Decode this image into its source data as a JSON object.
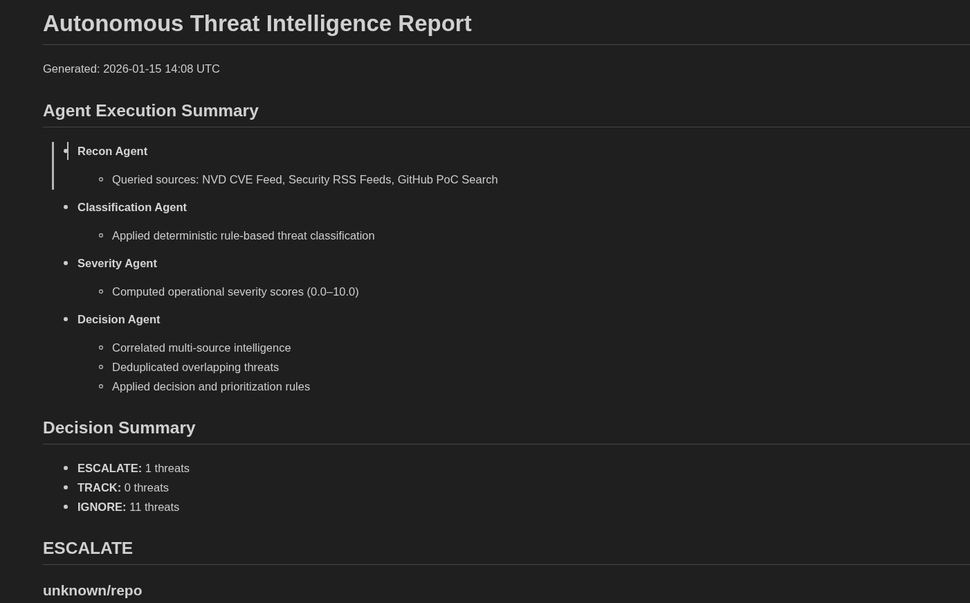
{
  "document": {
    "title": "Autonomous Threat Intelligence Report",
    "generated": "Generated: 2026-01-15 14:08 UTC"
  },
  "sections": [
    {
      "kind": "agents",
      "heading": "Agent Execution Summary",
      "items": [
        {
          "label": "Recon Agent",
          "highlighted": true,
          "children": [
            {
              "text": "Queried sources: NVD CVE Feed, Security RSS Feeds, GitHub PoC Search"
            }
          ]
        },
        {
          "label": "Classification Agent",
          "highlighted": false,
          "children": [
            {
              "text": "Applied deterministic rule-based threat classification"
            }
          ]
        },
        {
          "label": "Severity Agent",
          "highlighted": false,
          "children": [
            {
              "text": "Computed operational severity scores (0.0–10.0)"
            }
          ]
        },
        {
          "label": "Decision Agent",
          "highlighted": false,
          "children": [
            {
              "text": "Correlated multi-source intelligence"
            },
            {
              "text": "Deduplicated overlapping threats"
            },
            {
              "text": "Applied decision and prioritization rules"
            }
          ]
        }
      ]
    },
    {
      "kind": "counts",
      "heading": "Decision Summary",
      "items": [
        {
          "text": "**ESCALATE:** 1 threats"
        },
        {
          "text": "**TRACK:** 0 threats"
        },
        {
          "text": "**IGNORE:** 11 threats"
        }
      ]
    },
    {
      "kind": "threats",
      "heading": "ESCALATE",
      "items": [
        {
          "title": "unknown/repo"
        }
      ]
    }
  ]
}
